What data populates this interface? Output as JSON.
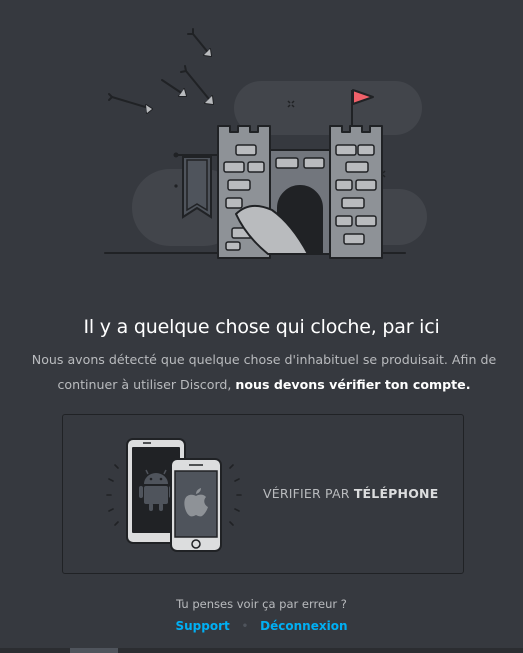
{
  "heading": "Il y a quelque chose qui cloche, par ici",
  "description": {
    "line1": "Nous avons détecté que quelque chose d'inhabituel se produisait. Afin de",
    "line2_prefix": "continuer à utiliser Discord, ",
    "line2_bold": "nous devons vérifier ton compte."
  },
  "verify_option": {
    "prefix": "VÉRIFIER PAR ",
    "method": "TÉLÉPHONE"
  },
  "footer": {
    "question": "Tu penses voir ça par erreur ?",
    "support_label": "Support",
    "logout_label": "Déconnexion",
    "separator": "•"
  },
  "colors": {
    "background": "#36393f",
    "link": "#00b0f4",
    "flag": "#f0616a"
  },
  "icons": [
    "castle-illustration",
    "arrow-icon",
    "flag-icon",
    "android-icon",
    "apple-icon"
  ]
}
